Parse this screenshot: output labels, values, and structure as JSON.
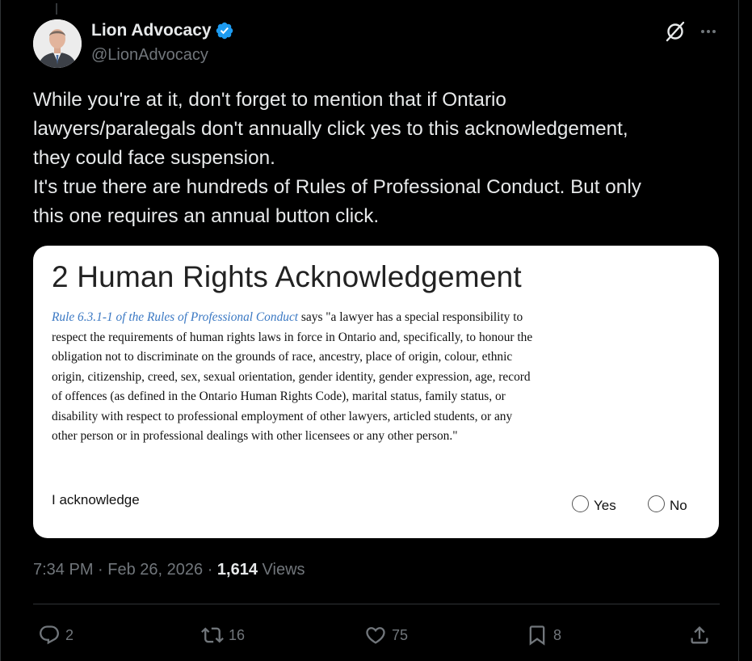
{
  "author": {
    "display_name": "Lion Advocacy",
    "handle": "@LionAdvocacy",
    "verified": true
  },
  "tweet": {
    "text": "While you're at it, don't forget to mention that if Ontario\nlawyers/paralegals don't annually click yes to this acknowledgement,\nthey could face suspension.\nIt's true there are hundreds of Rules of Professional Conduct. But only\nthis one requires an annual button click."
  },
  "card": {
    "title": "2 Human Rights Acknowledgement",
    "rule_link": "Rule 6.3.1-1 of the Rules of Professional Conduct",
    "rule_text": " says \"a lawyer has a special responsibility to respect the requirements of human rights laws in force in Ontario and, specifically, to honour the obligation not to discriminate on the grounds of race, ancestry, place of origin, colour, ethnic origin, citizenship, creed, sex, sexual orientation, gender identity, gender expression, age, record of offences (as defined in the Ontario Human Rights Code), marital status, family status, or disability with respect to professional employment of other lawyers, articled students, or any other person or in professional dealings with other licensees or any other person.\"",
    "ack_label": "I acknowledge",
    "options": [
      {
        "label": "Yes",
        "selected": false
      },
      {
        "label": "No",
        "selected": false
      }
    ]
  },
  "meta": {
    "time": "7:34 PM",
    "separator": " · ",
    "date": "Feb 26, 2026",
    "views_count": "1,614",
    "views_label": " Views"
  },
  "actions": {
    "replies": "2",
    "reposts": "16",
    "likes": "75",
    "bookmarks": "8"
  },
  "icons": [
    "verified-badge-icon",
    "grok-icon",
    "more-icon",
    "reply-icon",
    "repost-icon",
    "like-icon",
    "bookmark-icon",
    "share-icon"
  ],
  "colors": {
    "background": "#000000",
    "text": "#e7e9ea",
    "secondary": "#71767b",
    "verified": "#1d9bf0",
    "link": "#3a78c3"
  }
}
